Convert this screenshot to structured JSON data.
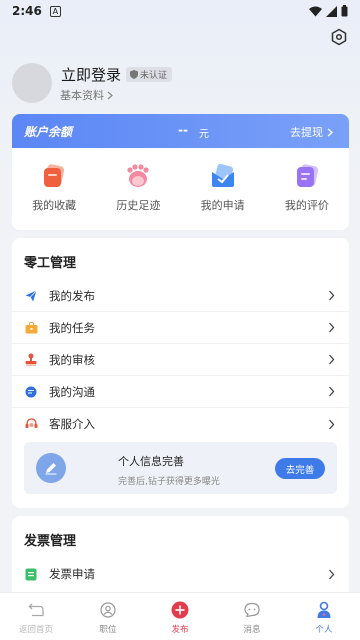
{
  "status_bar": {
    "time": "2:46",
    "notification_letter": "A"
  },
  "profile": {
    "login_label": "立即登录",
    "badge_label": "未认证",
    "basic_info_label": "基本资料"
  },
  "balance": {
    "title": "账户余额",
    "amount": "--",
    "unit": "元",
    "withdraw_label": "去提现"
  },
  "quick_actions": [
    {
      "label": "我的收藏",
      "icon": "favorites-icon"
    },
    {
      "label": "历史足迹",
      "icon": "footprint-icon"
    },
    {
      "label": "我的申请",
      "icon": "application-icon"
    },
    {
      "label": "我的评价",
      "icon": "review-icon"
    }
  ],
  "gig_management": {
    "title": "零工管理",
    "items": [
      {
        "label": "我的发布",
        "icon": "paper-plane-icon"
      },
      {
        "label": "我的任务",
        "icon": "briefcase-icon"
      },
      {
        "label": "我的审核",
        "icon": "stamp-icon"
      },
      {
        "label": "我的沟通",
        "icon": "chat-icon"
      },
      {
        "label": "客服介入",
        "icon": "headset-icon"
      }
    ],
    "promo": {
      "title": "个人信息完善",
      "subtitle": "完善后,钻子获得更多曝光",
      "button_label": "去完善"
    }
  },
  "invoice_management": {
    "title": "发票管理",
    "items": [
      {
        "label": "发票申请",
        "icon": "invoice-icon"
      }
    ]
  },
  "tab_bar": {
    "tabs": [
      {
        "label": "返回首页",
        "icon": "return-icon"
      },
      {
        "label": "职位",
        "icon": "job-icon"
      },
      {
        "label": "发布",
        "icon": "publish-plus-icon"
      },
      {
        "label": "消息",
        "icon": "message-icon"
      },
      {
        "label": "个人",
        "icon": "person-icon"
      }
    ],
    "active": "个人"
  },
  "colors": {
    "accent_blue": "#3f7be8",
    "balance_bar": "#5b86f5",
    "publish_red": "#e23b4e"
  }
}
